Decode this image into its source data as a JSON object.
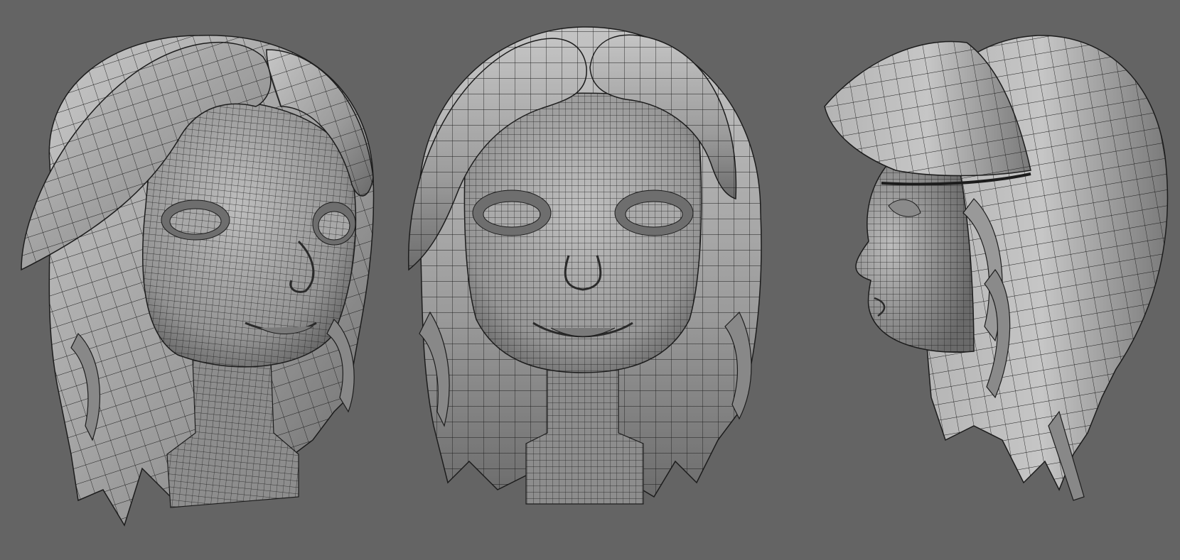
{
  "viewport": {
    "background": "#646464",
    "shading": {
      "light": "#c4c4c4",
      "mid": "#969696",
      "dark": "#505050",
      "wire": "#1c1c1c"
    }
  },
  "views": [
    {
      "name": "three-quarter-view",
      "icon": "head-wireframe-icon"
    },
    {
      "name": "front-view",
      "icon": "head-wireframe-icon"
    },
    {
      "name": "side-view",
      "icon": "head-wireframe-icon"
    }
  ]
}
